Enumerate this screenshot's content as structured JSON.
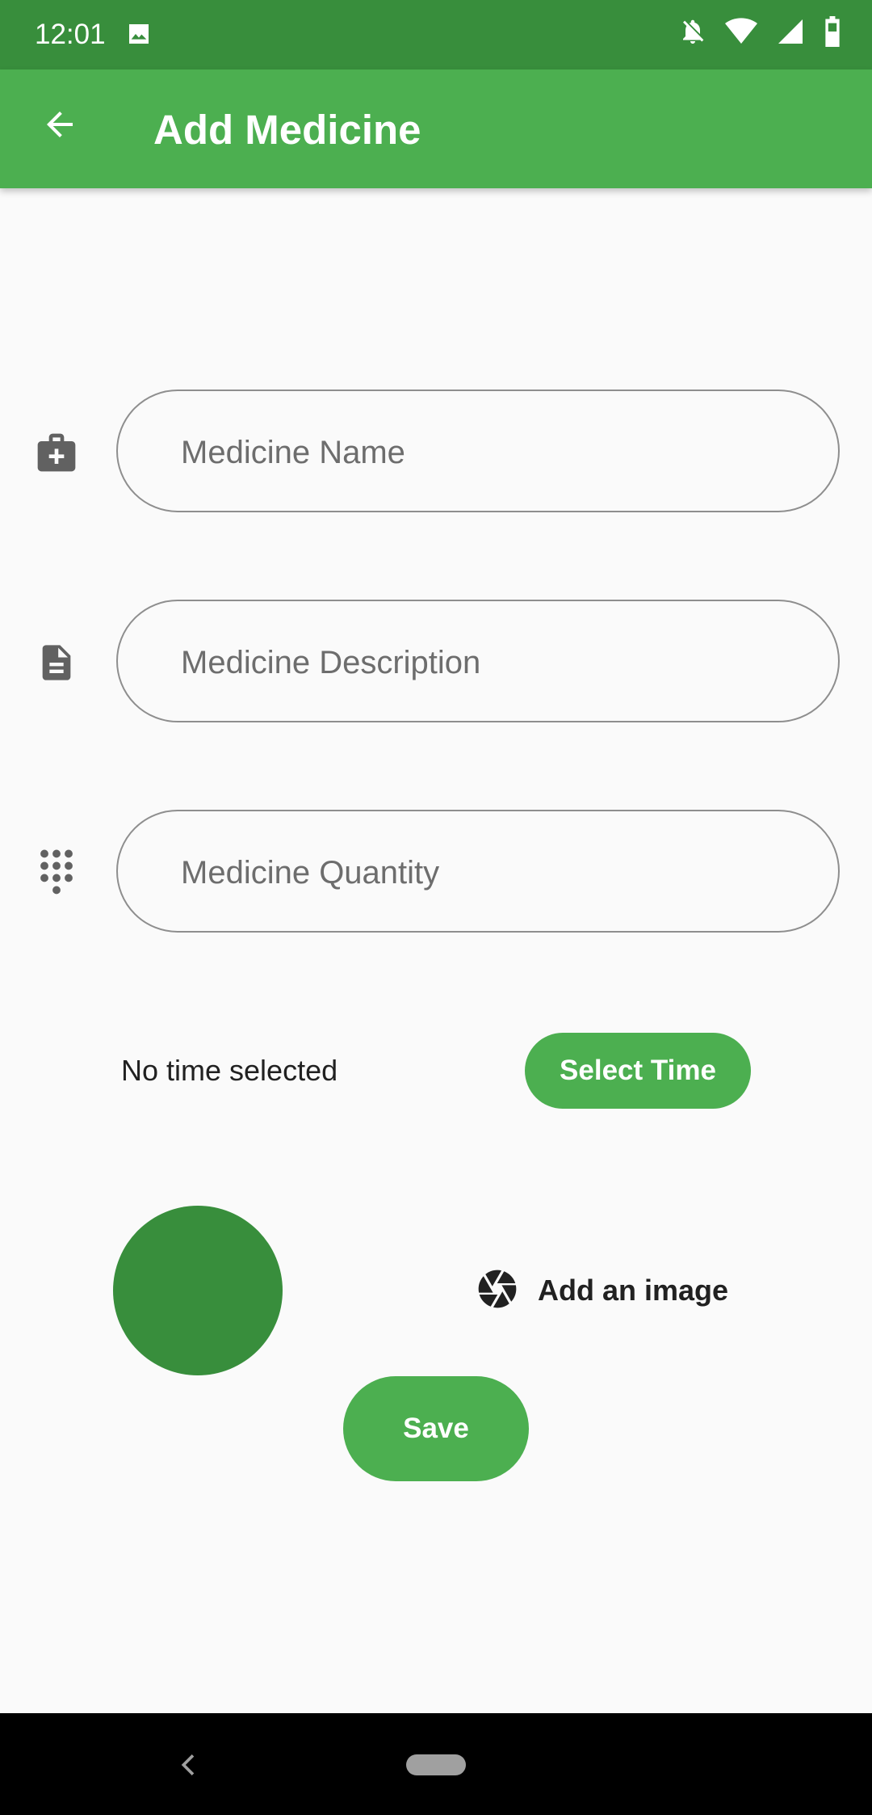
{
  "status_bar": {
    "time": "12:01",
    "icons": [
      "image-icon",
      "notifications-off-icon",
      "wifi-icon",
      "signal-icon",
      "battery-icon"
    ]
  },
  "app_bar": {
    "title": "Add Medicine",
    "back_icon": "arrow-back-icon",
    "color": "#4caf50"
  },
  "form": {
    "fields": [
      {
        "icon": "medical-bag-icon",
        "placeholder": "Medicine Name"
      },
      {
        "icon": "document-icon",
        "placeholder": "Medicine Description"
      },
      {
        "icon": "dialpad-icon",
        "placeholder": "Medicine Quantity"
      }
    ],
    "time_status": "No time selected",
    "select_time_label": "Select Time",
    "add_image_label": "Add an image",
    "add_image_icon": "camera-shutter-icon",
    "save_label": "Save"
  },
  "colors": {
    "primary": "#4caf50",
    "primary_dark": "#388e3c",
    "background": "#fafafa"
  }
}
